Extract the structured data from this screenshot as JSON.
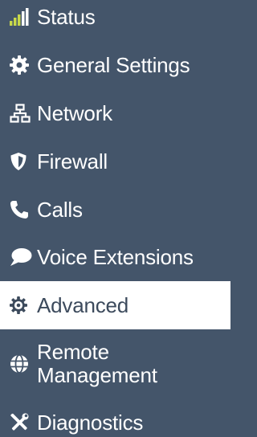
{
  "colors": {
    "sidebar_bg": "#44556a",
    "text": "#ffffff",
    "active_bg": "#ffffff",
    "active_text": "#3c4a5c",
    "signal_accent": "#c8d84a"
  },
  "sidebar": {
    "items": [
      {
        "label": "Status",
        "icon": "signal-bars-icon",
        "active": false
      },
      {
        "label": "General Settings",
        "icon": "gear-icon",
        "active": false
      },
      {
        "label": "Network",
        "icon": "network-icon",
        "active": false
      },
      {
        "label": "Firewall",
        "icon": "shield-icon",
        "active": false
      },
      {
        "label": "Calls",
        "icon": "phone-icon",
        "active": false
      },
      {
        "label": "Voice Extensions",
        "icon": "speech-bubble-icon",
        "active": false
      },
      {
        "label": "Advanced",
        "icon": "cog-icon",
        "active": true
      },
      {
        "label": "Remote\nManagement",
        "icon": "globe-icon",
        "active": false
      },
      {
        "label": "Diagnostics",
        "icon": "tools-icon",
        "active": false
      }
    ]
  }
}
